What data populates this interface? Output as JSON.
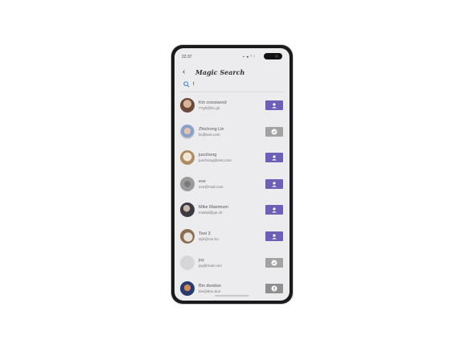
{
  "status": {
    "time": "22:37",
    "icons": "▪ ◂ ᵀ ᴵ"
  },
  "header": {
    "back": "‹",
    "title": "Magic Search"
  },
  "search": {
    "value": "t",
    "placeholder": ""
  },
  "colors": {
    "accent": "#6b5fb6",
    "done": "#a2a2a2",
    "pending": "#8f8f8f"
  },
  "users": [
    {
      "name": "Kin crossword",
      "email": "77gh@hn.gh",
      "action": "add"
    },
    {
      "name": "Zhichong Lin",
      "email": "lin@test.com",
      "action": "done"
    },
    {
      "name": "junchong",
      "email": "junchong@test.com",
      "action": "add"
    },
    {
      "name": "eve",
      "email": "eve@mail.com",
      "action": "add"
    },
    {
      "name": "Mike Maximum",
      "email": "mokkd@ge.ch",
      "action": "add"
    },
    {
      "name": "Test 3",
      "email": "dyh@mn.fcc",
      "action": "add"
    },
    {
      "name": "joy",
      "email": "jay@mail.com",
      "action": "done"
    },
    {
      "name": "Bin dundun",
      "email": "bin@dun.dun",
      "action": "pending"
    }
  ]
}
